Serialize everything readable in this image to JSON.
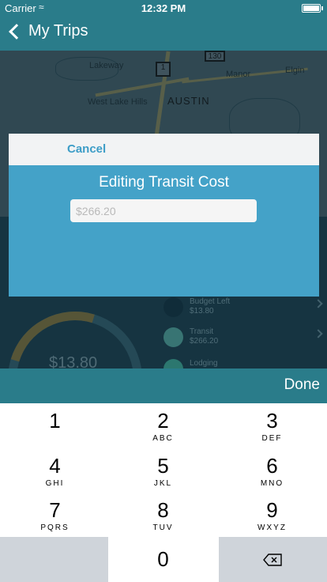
{
  "status_bar": {
    "carrier": "Carrier",
    "time": "12:32 PM"
  },
  "nav": {
    "back_label": "My Trips"
  },
  "map": {
    "labels": [
      "Lakeway",
      "West Lake Hills",
      "AUSTIN",
      "Manor",
      "Elgin"
    ],
    "shields": [
      "1",
      "130"
    ]
  },
  "background": {
    "donut_value": "$13.80",
    "legend": [
      {
        "name": "Budget Left",
        "amount": "$13.80",
        "color": "#0f2c3a"
      },
      {
        "name": "Transit",
        "amount": "$266.20",
        "color": "#4c9a92"
      },
      {
        "name": "Lodging",
        "amount": "",
        "color": "#3a9f8c"
      }
    ]
  },
  "modal": {
    "cancel_label": "Cancel",
    "title": "Editing Transit Cost",
    "input_placeholder": "$266.20",
    "input_value": ""
  },
  "toolbar": {
    "done_label": "Done"
  },
  "keypad": {
    "keys": [
      {
        "digit": "1",
        "letters": ""
      },
      {
        "digit": "2",
        "letters": "ABC"
      },
      {
        "digit": "3",
        "letters": "DEF"
      },
      {
        "digit": "4",
        "letters": "GHI"
      },
      {
        "digit": "5",
        "letters": "JKL"
      },
      {
        "digit": "6",
        "letters": "MNO"
      },
      {
        "digit": "7",
        "letters": "PQRS"
      },
      {
        "digit": "8",
        "letters": "TUV"
      },
      {
        "digit": "9",
        "letters": "WXYZ"
      },
      {
        "digit": "0",
        "letters": ""
      }
    ]
  }
}
